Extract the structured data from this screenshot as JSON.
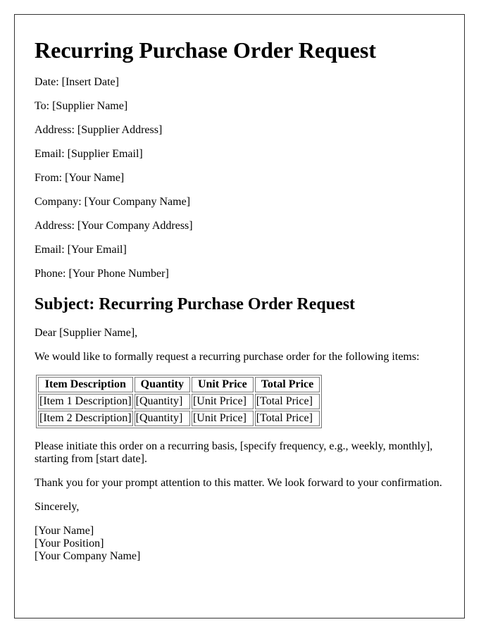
{
  "title": "Recurring Purchase Order Request",
  "fields": [
    "Date: [Insert Date]",
    "To: [Supplier Name]",
    "Address: [Supplier Address]",
    "Email: [Supplier Email]",
    "From: [Your Name]",
    "Company: [Your Company Name]",
    "Address: [Your Company Address]",
    "Email: [Your Email]",
    "Phone: [Your Phone Number]"
  ],
  "subject": "Subject: Recurring Purchase Order Request",
  "salutation": "Dear [Supplier Name],",
  "intro": "We would like to formally request a recurring purchase order for the following items:",
  "table": {
    "headers": [
      "Item Description",
      "Quantity",
      "Unit Price",
      "Total Price"
    ],
    "rows": [
      [
        "[Item 1 Description]",
        "[Quantity]",
        "[Unit Price]",
        "[Total Price]"
      ],
      [
        "[Item 2 Description]",
        "[Quantity]",
        "[Unit Price]",
        "[Total Price]"
      ]
    ]
  },
  "body1": "Please initiate this order on a recurring basis, [specify frequency, e.g., weekly, monthly], starting from [start date].",
  "body2": "Thank you for your prompt attention to this matter. We look forward to your confirmation.",
  "closing": "Sincerely,",
  "signature": [
    "[Your Name]",
    "[Your Position]",
    "[Your Company Name]"
  ]
}
